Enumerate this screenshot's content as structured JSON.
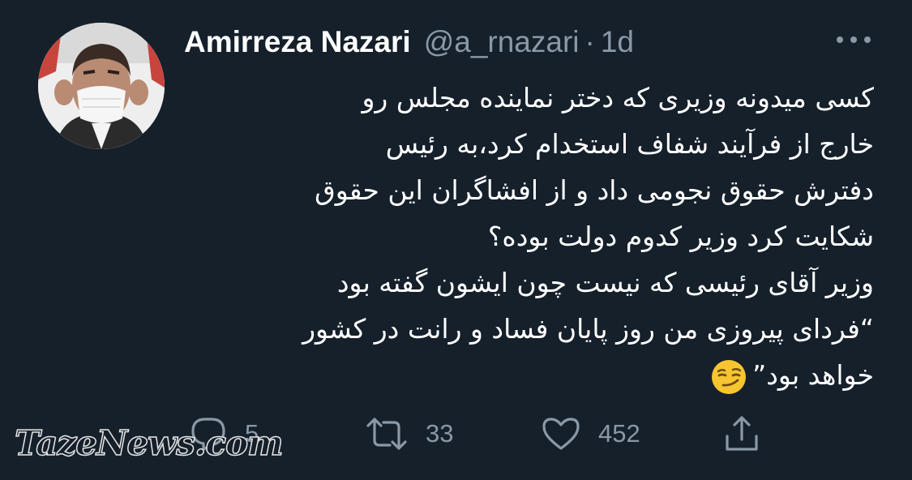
{
  "tweet": {
    "author_name": "Amirreza Nazari",
    "handle": "@a_rnazari",
    "separator": "·",
    "time": "1d",
    "lines": [
      "کسی میدونه وزیری که دختر نماینده مجلس رو",
      "خارج از فرآیند شفاف استخدام کرد،به رئیس",
      "دفترش حقوق نجومی داد و از افشاگران این حقوق",
      "شکایت کرد وزیر کدوم دولت بوده؟",
      "وزیر آقای رئیسی که نیست چون ایشون گفته بود",
      "“فردای پیروزی من روز پایان فساد و رانت در کشور",
      "خواهد بود”"
    ],
    "trailing_emoji": "smirking-face-emoji"
  },
  "actions": {
    "reply_count": "5",
    "retweet_count": "33",
    "like_count": "452"
  },
  "watermark": "TazeNews.com",
  "icons": {
    "more": "more-horizontal-icon",
    "reply": "reply-icon",
    "retweet": "retweet-icon",
    "like": "like-icon",
    "share": "share-icon"
  },
  "colors": {
    "background": "#15202b",
    "primary_text": "#ffffff",
    "secondary_text": "#8b98a5"
  }
}
